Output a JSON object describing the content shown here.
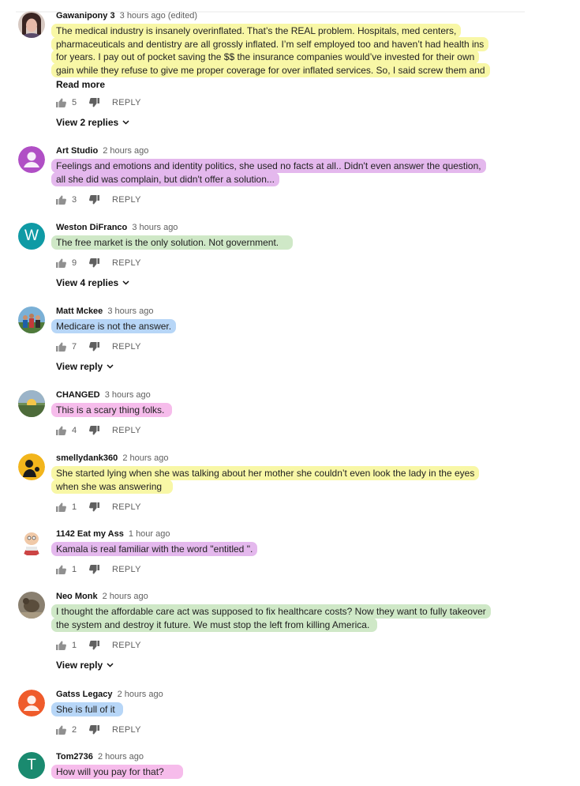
{
  "comments": [
    {
      "author": "Gawanipony 3",
      "time": "3 hours ago (edited)",
      "lines": [
        "The medical industry is insanely overinflated. That’s the REAL problem. Hospitals, med centers,",
        "pharmaceuticals and dentistry are all grossly inflated. I’m self employed too and haven’t had health ins",
        "for years. I pay out of pocket saving the $$ the insurance companies would’ve invested for their own",
        "gain while they refuse to give me proper coverage for over inflated services. So, I said screw them and"
      ],
      "read_more": "Read more",
      "likes": "5",
      "reply_label": "REPLY",
      "view_replies": "View 2 replies",
      "highlight": "yellow",
      "avatar_icon": "profile-photo-woman"
    },
    {
      "author": "Art Studio",
      "time": "2 hours ago",
      "lines": [
        "Feelings and emotions and identity politics,  she used no facts at all..  Didn't even answer the question,",
        "all she did was complain,  but didn't offer a solution..."
      ],
      "likes": "3",
      "reply_label": "REPLY",
      "highlight": "purple",
      "avatar_icon": "default-user-icon",
      "avatar_color": "#b04fc5"
    },
    {
      "author": "Weston DiFranco",
      "time": "3 hours ago",
      "lines": [
        "The free market is the only solution. Not government."
      ],
      "likes": "9",
      "reply_label": "REPLY",
      "view_replies": "View 4 replies",
      "highlight": "green",
      "avatar_letter": "W",
      "avatar_color": "#0f9aa5"
    },
    {
      "author": "Matt Mckee",
      "time": "3 hours ago",
      "lines": [
        "Medicare is not the answer."
      ],
      "likes": "7",
      "reply_label": "REPLY",
      "view_replies": "View reply",
      "highlight": "blue",
      "avatar_icon": "group-photo"
    },
    {
      "author": "CHANGED",
      "time": "3 hours ago",
      "lines": [
        "This is a scary thing folks."
      ],
      "likes": "4",
      "reply_label": "REPLY",
      "highlight": "pink",
      "avatar_icon": "sunset-photo"
    },
    {
      "author": "smellydank360",
      "time": "2 hours ago",
      "lines": [
        "She started lying when she was talking about her mother she couldn’t even look the lady in the eyes",
        "when she was answering"
      ],
      "likes": "1",
      "reply_label": "REPLY",
      "highlight": "yellow",
      "avatar_icon": "silhouette-yellow"
    },
    {
      "author": "1142 Eat my Ass",
      "time": "1 hour ago",
      "lines": [
        "Kamala is real familiar with the word \"entitled \"."
      ],
      "likes": "1",
      "reply_label": "REPLY",
      "highlight": "purple",
      "avatar_icon": "cartoon-character"
    },
    {
      "author": "Neo Monk",
      "time": "2 hours ago",
      "lines": [
        "I thought the affordable care act was supposed to fix healthcare costs? Now they want to fully takeover",
        "the system and destroy it future. We must stop the left from killing America."
      ],
      "likes": "1",
      "reply_label": "REPLY",
      "view_replies": "View reply",
      "highlight": "green",
      "avatar_icon": "animal-photo"
    },
    {
      "author": "Gatss Legacy",
      "time": "2 hours ago",
      "lines": [
        "She is full of it"
      ],
      "likes": "2",
      "reply_label": "REPLY",
      "highlight": "blue",
      "avatar_icon": "default-user-icon",
      "avatar_color": "#ef5b2b"
    },
    {
      "author": "Tom2736",
      "time": "2 hours ago",
      "lines": [
        "How will you pay for that?"
      ],
      "highlight": "pink",
      "avatar_letter": "T",
      "avatar_color": "#1a8a6f"
    }
  ]
}
